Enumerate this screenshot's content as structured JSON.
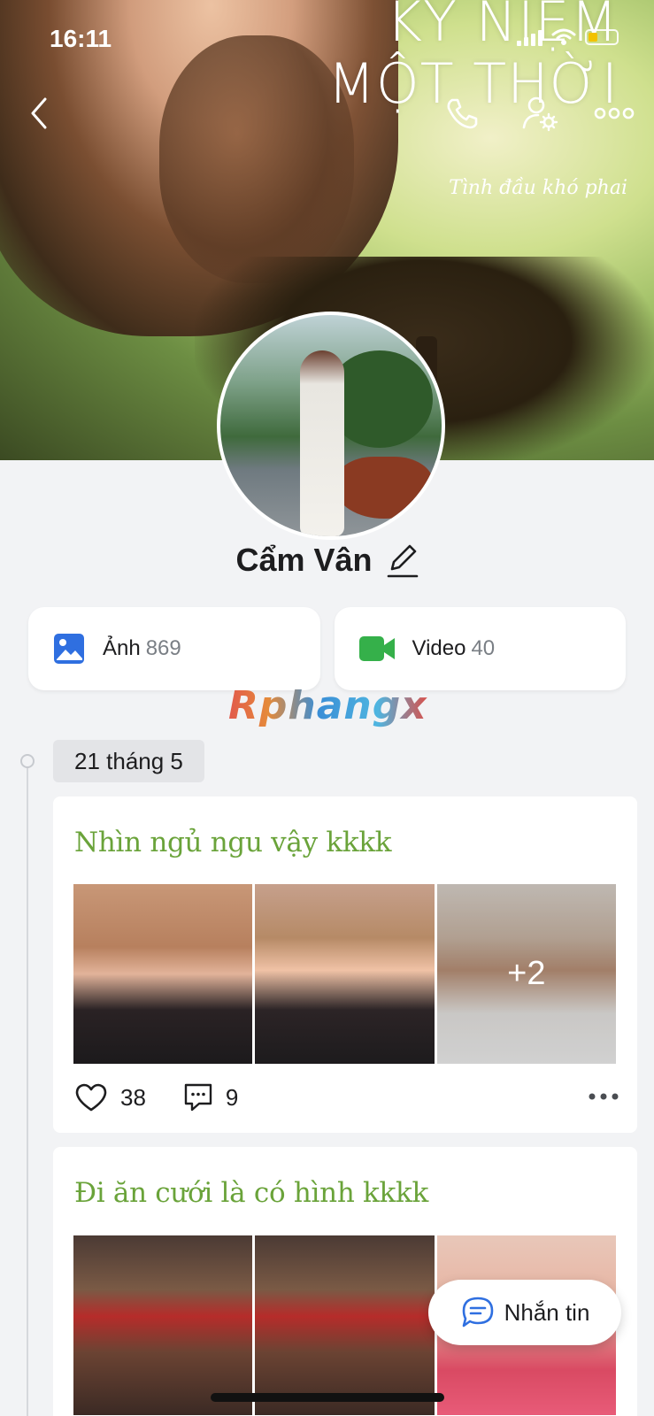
{
  "status": {
    "time": "16:11"
  },
  "cover": {
    "title_line1": "KỶ NIỆM",
    "title_line2": "MỘT THỜI",
    "subtitle": "Tình đầu khó phai"
  },
  "profile": {
    "name": "Cẩm Vân"
  },
  "media": [
    {
      "label": "Ảnh",
      "count": "869",
      "icon": "image-icon",
      "color": "#2f6fe0"
    },
    {
      "label": "Video",
      "count": "40",
      "icon": "video-camera-icon",
      "color": "#35b04a"
    }
  ],
  "watermark": "Rphangx",
  "timeline": {
    "date": "21 tháng 5",
    "posts": [
      {
        "title": "Nhìn ngủ ngu vậy kkkk",
        "more_photos": "+2",
        "likes": "38",
        "comments": "9"
      },
      {
        "title": "Đi ăn cưới là có hình kkkk"
      }
    ]
  },
  "fab": {
    "label": "Nhắn tin"
  },
  "colors": {
    "accent": "#2f6fe0",
    "post_title": "#6aa33a",
    "video": "#35b04a"
  }
}
